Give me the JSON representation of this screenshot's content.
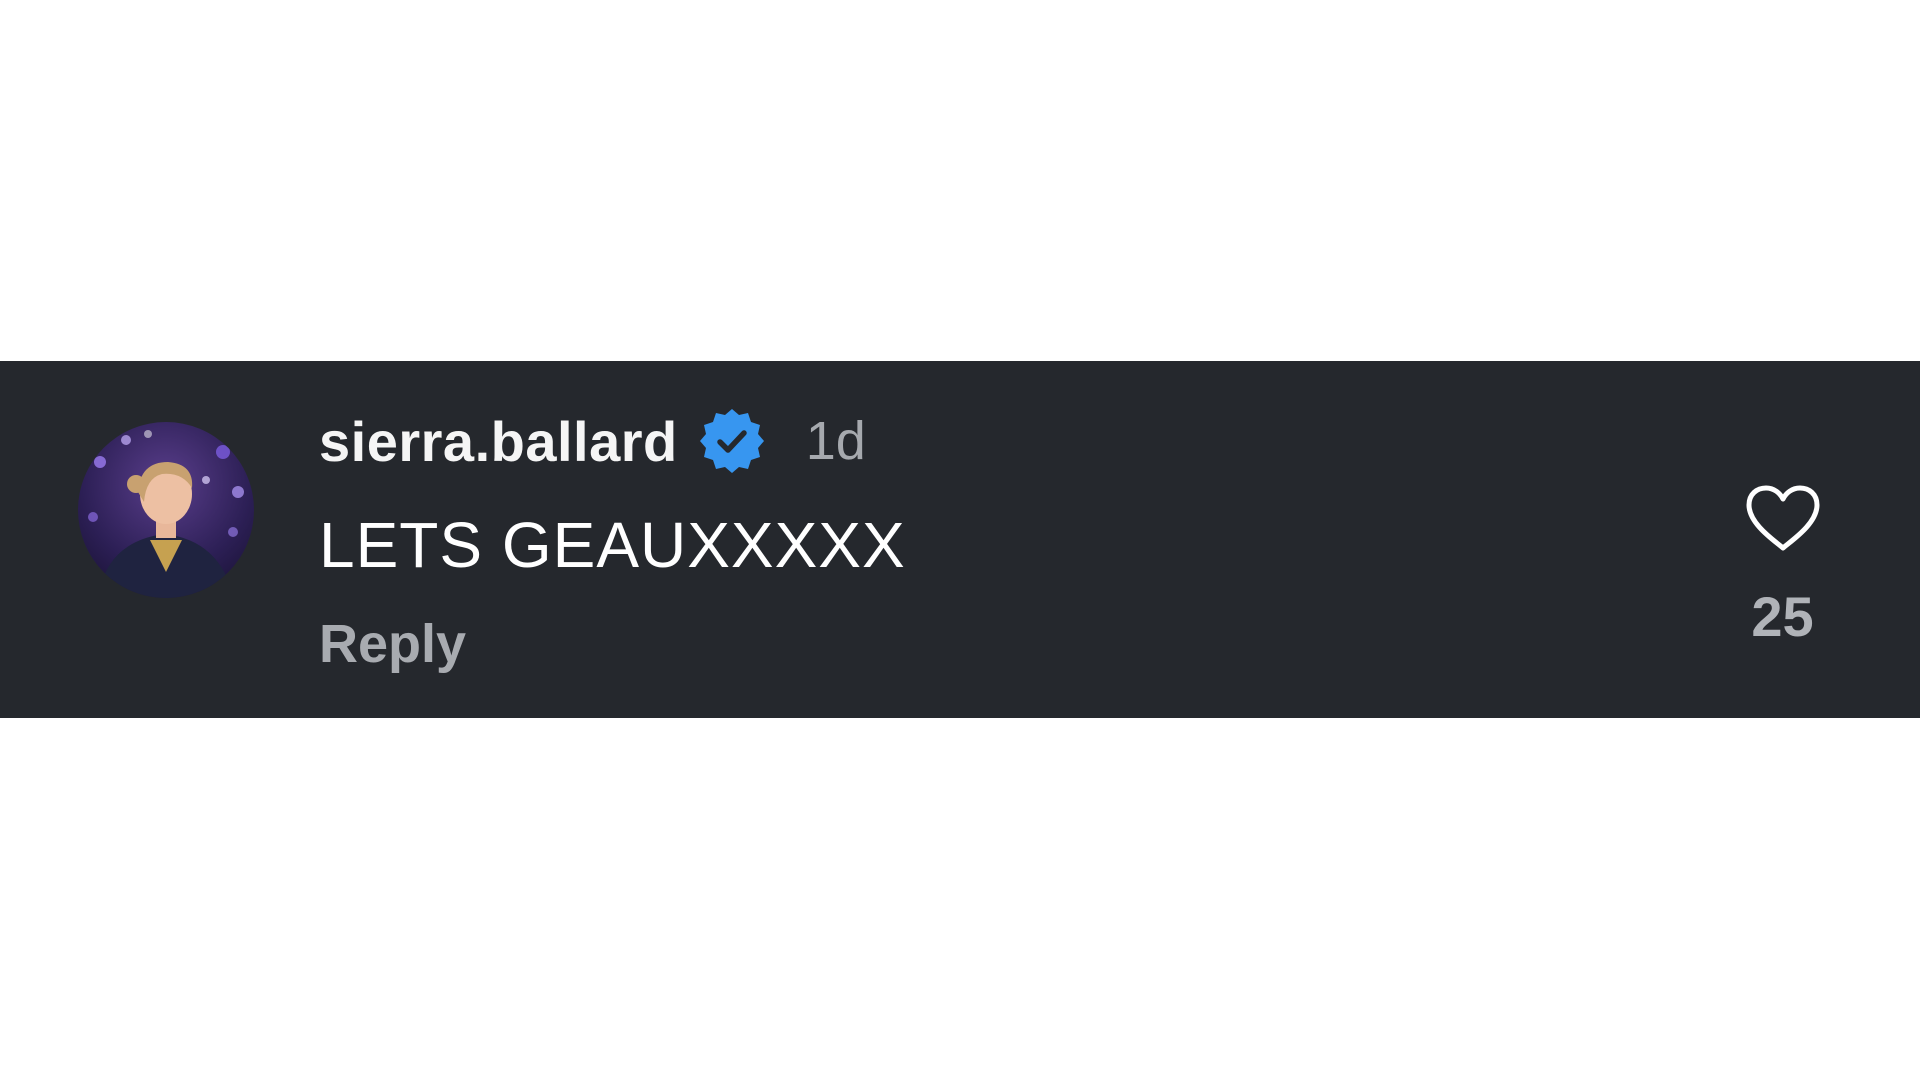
{
  "comment": {
    "username": "sierra.ballard",
    "verified": true,
    "verified_icon": "verified-badge-icon",
    "timestamp": "1d",
    "text": "LETS GEAUXXXXX",
    "reply_label": "Reply",
    "like_icon": "heart-outline-icon",
    "like_count": "25"
  },
  "colors": {
    "band_background": "#25282d",
    "verified_blue": "#3796f0",
    "muted_text": "#a8abb0"
  }
}
